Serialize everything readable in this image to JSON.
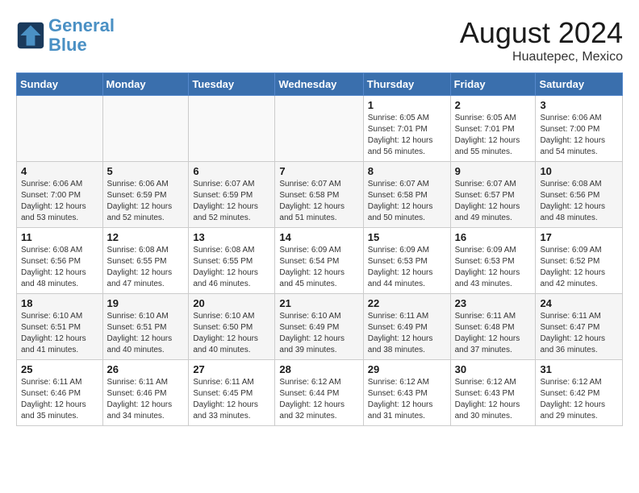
{
  "header": {
    "logo_line1": "General",
    "logo_line2": "Blue",
    "month_year": "August 2024",
    "location": "Huautepec, Mexico"
  },
  "days_of_week": [
    "Sunday",
    "Monday",
    "Tuesday",
    "Wednesday",
    "Thursday",
    "Friday",
    "Saturday"
  ],
  "weeks": [
    [
      {
        "day": "",
        "detail": ""
      },
      {
        "day": "",
        "detail": ""
      },
      {
        "day": "",
        "detail": ""
      },
      {
        "day": "",
        "detail": ""
      },
      {
        "day": "1",
        "detail": "Sunrise: 6:05 AM\nSunset: 7:01 PM\nDaylight: 12 hours\nand 56 minutes."
      },
      {
        "day": "2",
        "detail": "Sunrise: 6:05 AM\nSunset: 7:01 PM\nDaylight: 12 hours\nand 55 minutes."
      },
      {
        "day": "3",
        "detail": "Sunrise: 6:06 AM\nSunset: 7:00 PM\nDaylight: 12 hours\nand 54 minutes."
      }
    ],
    [
      {
        "day": "4",
        "detail": "Sunrise: 6:06 AM\nSunset: 7:00 PM\nDaylight: 12 hours\nand 53 minutes."
      },
      {
        "day": "5",
        "detail": "Sunrise: 6:06 AM\nSunset: 6:59 PM\nDaylight: 12 hours\nand 52 minutes."
      },
      {
        "day": "6",
        "detail": "Sunrise: 6:07 AM\nSunset: 6:59 PM\nDaylight: 12 hours\nand 52 minutes."
      },
      {
        "day": "7",
        "detail": "Sunrise: 6:07 AM\nSunset: 6:58 PM\nDaylight: 12 hours\nand 51 minutes."
      },
      {
        "day": "8",
        "detail": "Sunrise: 6:07 AM\nSunset: 6:58 PM\nDaylight: 12 hours\nand 50 minutes."
      },
      {
        "day": "9",
        "detail": "Sunrise: 6:07 AM\nSunset: 6:57 PM\nDaylight: 12 hours\nand 49 minutes."
      },
      {
        "day": "10",
        "detail": "Sunrise: 6:08 AM\nSunset: 6:56 PM\nDaylight: 12 hours\nand 48 minutes."
      }
    ],
    [
      {
        "day": "11",
        "detail": "Sunrise: 6:08 AM\nSunset: 6:56 PM\nDaylight: 12 hours\nand 48 minutes."
      },
      {
        "day": "12",
        "detail": "Sunrise: 6:08 AM\nSunset: 6:55 PM\nDaylight: 12 hours\nand 47 minutes."
      },
      {
        "day": "13",
        "detail": "Sunrise: 6:08 AM\nSunset: 6:55 PM\nDaylight: 12 hours\nand 46 minutes."
      },
      {
        "day": "14",
        "detail": "Sunrise: 6:09 AM\nSunset: 6:54 PM\nDaylight: 12 hours\nand 45 minutes."
      },
      {
        "day": "15",
        "detail": "Sunrise: 6:09 AM\nSunset: 6:53 PM\nDaylight: 12 hours\nand 44 minutes."
      },
      {
        "day": "16",
        "detail": "Sunrise: 6:09 AM\nSunset: 6:53 PM\nDaylight: 12 hours\nand 43 minutes."
      },
      {
        "day": "17",
        "detail": "Sunrise: 6:09 AM\nSunset: 6:52 PM\nDaylight: 12 hours\nand 42 minutes."
      }
    ],
    [
      {
        "day": "18",
        "detail": "Sunrise: 6:10 AM\nSunset: 6:51 PM\nDaylight: 12 hours\nand 41 minutes."
      },
      {
        "day": "19",
        "detail": "Sunrise: 6:10 AM\nSunset: 6:51 PM\nDaylight: 12 hours\nand 40 minutes."
      },
      {
        "day": "20",
        "detail": "Sunrise: 6:10 AM\nSunset: 6:50 PM\nDaylight: 12 hours\nand 40 minutes."
      },
      {
        "day": "21",
        "detail": "Sunrise: 6:10 AM\nSunset: 6:49 PM\nDaylight: 12 hours\nand 39 minutes."
      },
      {
        "day": "22",
        "detail": "Sunrise: 6:11 AM\nSunset: 6:49 PM\nDaylight: 12 hours\nand 38 minutes."
      },
      {
        "day": "23",
        "detail": "Sunrise: 6:11 AM\nSunset: 6:48 PM\nDaylight: 12 hours\nand 37 minutes."
      },
      {
        "day": "24",
        "detail": "Sunrise: 6:11 AM\nSunset: 6:47 PM\nDaylight: 12 hours\nand 36 minutes."
      }
    ],
    [
      {
        "day": "25",
        "detail": "Sunrise: 6:11 AM\nSunset: 6:46 PM\nDaylight: 12 hours\nand 35 minutes."
      },
      {
        "day": "26",
        "detail": "Sunrise: 6:11 AM\nSunset: 6:46 PM\nDaylight: 12 hours\nand 34 minutes."
      },
      {
        "day": "27",
        "detail": "Sunrise: 6:11 AM\nSunset: 6:45 PM\nDaylight: 12 hours\nand 33 minutes."
      },
      {
        "day": "28",
        "detail": "Sunrise: 6:12 AM\nSunset: 6:44 PM\nDaylight: 12 hours\nand 32 minutes."
      },
      {
        "day": "29",
        "detail": "Sunrise: 6:12 AM\nSunset: 6:43 PM\nDaylight: 12 hours\nand 31 minutes."
      },
      {
        "day": "30",
        "detail": "Sunrise: 6:12 AM\nSunset: 6:43 PM\nDaylight: 12 hours\nand 30 minutes."
      },
      {
        "day": "31",
        "detail": "Sunrise: 6:12 AM\nSunset: 6:42 PM\nDaylight: 12 hours\nand 29 minutes."
      }
    ]
  ]
}
